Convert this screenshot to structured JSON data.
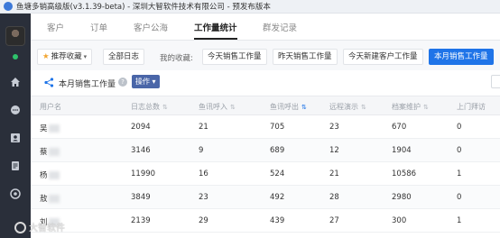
{
  "window": {
    "title": "鱼塘多销高级版(v3.1.39-beta) - 深圳大智软件技术有限公司 - 预发布版本"
  },
  "nav": {
    "tabs": [
      {
        "label": "客户",
        "active": false
      },
      {
        "label": "订单",
        "active": false
      },
      {
        "label": "客户公海",
        "active": false
      },
      {
        "label": "工作量统计",
        "active": true
      },
      {
        "label": "群发记录",
        "active": false
      }
    ]
  },
  "toolbar": {
    "recommend_label": "推荐收藏",
    "all_log_label": "全部日志",
    "favorites_label": "我的收藏:",
    "favorites": [
      {
        "label": "今天销售工作量",
        "active": false
      },
      {
        "label": "昨天销售工作量",
        "active": false
      },
      {
        "label": "今天新建客户工作量",
        "active": false
      },
      {
        "label": "本月销售工作量",
        "active": true
      }
    ]
  },
  "section": {
    "title": "本月销售工作量",
    "help_glyph": "?",
    "operation_label": "操作"
  },
  "table": {
    "columns": [
      "用户名",
      "日志总数",
      "鱼讯呼入",
      "鱼讯呼出",
      "远程演示",
      "档案维护",
      "上门拜访"
    ],
    "rows": [
      [
        "吴",
        "2094",
        "21",
        "705",
        "23",
        "670",
        "0"
      ],
      [
        "蔡",
        "3146",
        "9",
        "689",
        "12",
        "1904",
        "0"
      ],
      [
        "杨",
        "11990",
        "16",
        "524",
        "21",
        "10586",
        "1"
      ],
      [
        "敖",
        "3849",
        "23",
        "492",
        "28",
        "2980",
        "0"
      ],
      [
        "刘",
        "2139",
        "29",
        "439",
        "27",
        "300",
        "1"
      ]
    ]
  },
  "watermark": {
    "text": "大智软件"
  },
  "colors": {
    "accent": "#1f74e8",
    "sidebar": "#2a2f3a",
    "online": "#2ec26b"
  }
}
